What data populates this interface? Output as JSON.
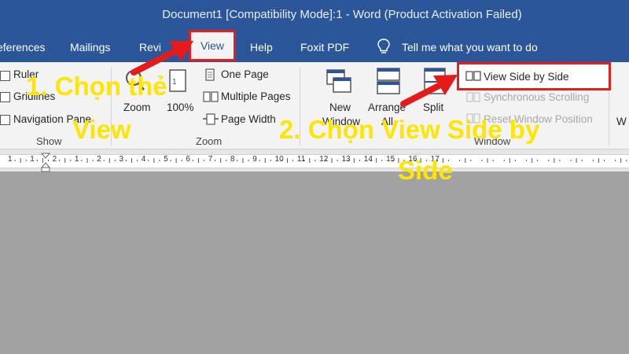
{
  "window": {
    "title": "Document1 [Compatibility Mode]:1  -  Word (Product Activation Failed)"
  },
  "tabs": [
    {
      "label": "eferences"
    },
    {
      "label": "Mailings"
    },
    {
      "label": "Revi"
    },
    {
      "label": "View"
    },
    {
      "label": "Help"
    },
    {
      "label": "Foxit PDF"
    }
  ],
  "tell_me": {
    "label": "Tell me what you want to do",
    "icon": "lightbulb-icon"
  },
  "ribbon": {
    "show": {
      "group_label": "Show",
      "ruler": "Ruler",
      "gridlines": "Gridlines",
      "navigation_pane": "Navigation Pane"
    },
    "zoom": {
      "group_label": "Zoom",
      "zoom_label": "Zoom",
      "hundred_label": "100%",
      "one_page": "One Page",
      "multiple_pages": "Multiple Pages",
      "page_width": "Page Width"
    },
    "window": {
      "group_label": "Window",
      "new_window_line1": "New",
      "new_window_line2": "Window",
      "arrange_all_line1": "Arrange",
      "arrange_all_line2": "All",
      "split": "Split",
      "view_side_by_side": "View Side by Side",
      "synchronous_scrolling": "Synchronous Scrolling",
      "reset_window_position": "Reset Window Position",
      "partial_next": "W"
    }
  },
  "ruler": {
    "numbers": [
      "1",
      "1",
      "2",
      "1",
      "2",
      "3",
      "4",
      "5",
      "6",
      "7",
      "8",
      "9",
      "10",
      "11",
      "12",
      "13",
      "14",
      "15",
      "16",
      "17"
    ]
  },
  "annotations": {
    "step1_line1": "1. Chọn thẻ",
    "step1_line2": "View",
    "step2_line1": "2. Chọn View Side by",
    "step2_line2": "Side"
  },
  "colors": {
    "title_bar": "#2b579a",
    "ribbon": "#f3f3f3",
    "document_background": "#a2a2a2",
    "highlight_red": "#e02020",
    "annotation_yellow": "#ffe500"
  }
}
